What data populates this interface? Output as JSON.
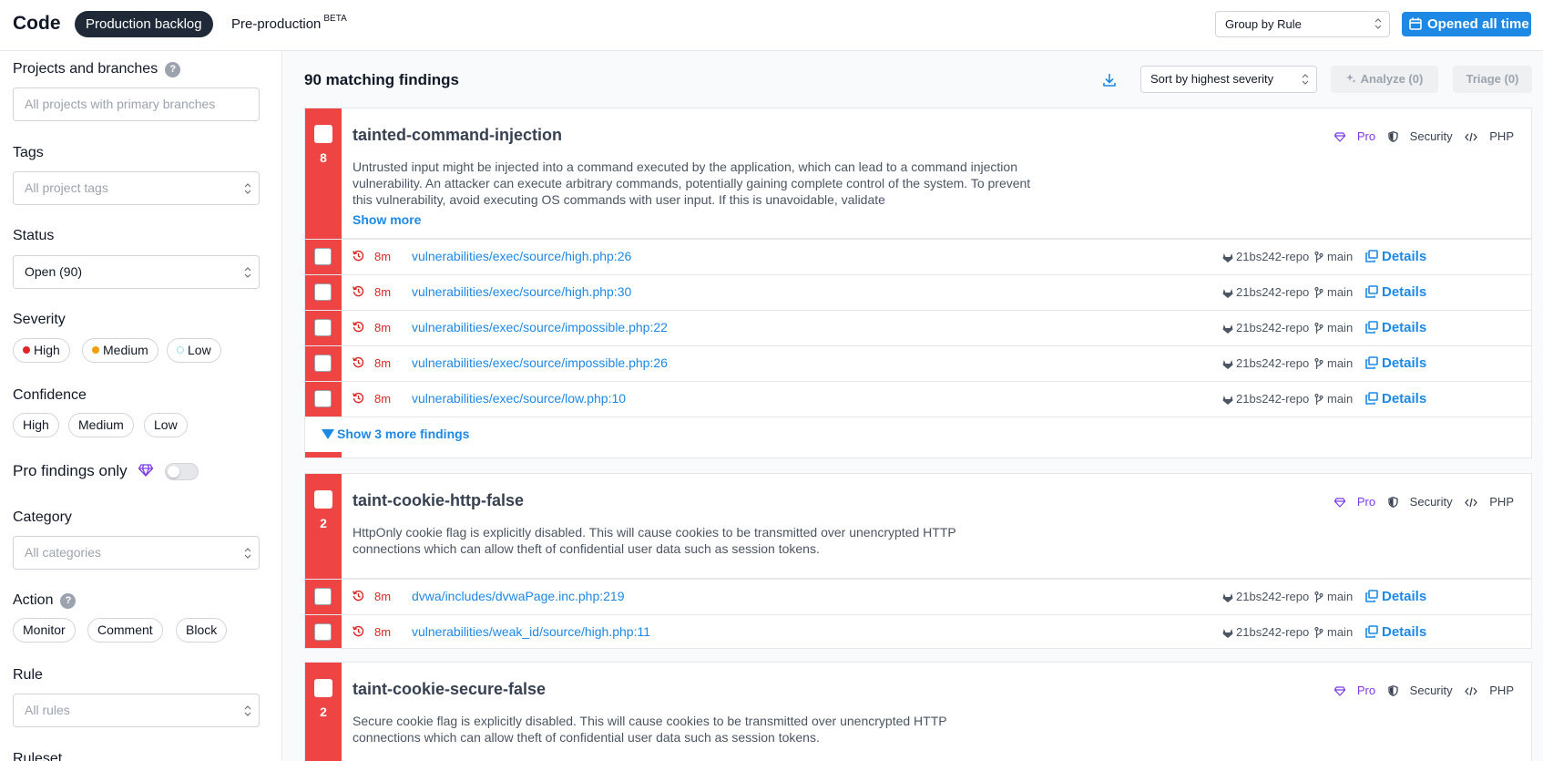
{
  "header": {
    "brand": "Code",
    "tab_production": "Production backlog",
    "tab_preproduction": "Pre-production",
    "tab_preproduction_badge": "BETA",
    "group_by": "Group by Rule",
    "opened_btn": "Opened all time"
  },
  "sidebar": {
    "projects_label": "Projects and branches",
    "projects_placeholder": "All projects with primary branches",
    "tags_label": "Tags",
    "tags_placeholder": "All project tags",
    "status_label": "Status",
    "status_value": "Open (90)",
    "severity_label": "Severity",
    "severity_options": [
      {
        "label": "High",
        "color": "#dc2626"
      },
      {
        "label": "Medium",
        "color": "#f59e0b"
      },
      {
        "label": "Low",
        "color": "#a5e4ef"
      }
    ],
    "confidence_label": "Confidence",
    "confidence_options": [
      "High",
      "Medium",
      "Low"
    ],
    "pro_label": "Pro findings only",
    "category_label": "Category",
    "category_placeholder": "All categories",
    "action_label": "Action",
    "action_options": [
      "Monitor",
      "Comment",
      "Block"
    ],
    "rule_label": "Rule",
    "rule_placeholder": "All rules",
    "ruleset_label": "Ruleset"
  },
  "main": {
    "count_title": "90 matching findings",
    "sort_by": "Sort by highest severity",
    "analyze": "Analyze (0)",
    "triage": "Triage (0)",
    "groups": [
      {
        "rule": "tainted-command-injection",
        "count": "8",
        "tags": [
          "Pro",
          "Security",
          "PHP"
        ],
        "description": "Untrusted input might be injected into a command executed by the application, which can lead to a command injection vulnerability. An attacker can execute arbitrary commands, potentially gaining complete control of the system. To prevent this vulnerability, avoid executing OS commands with user input. If this is unavoidable, validate",
        "show_more": "Show more",
        "show_findings": "Show 3 more findings",
        "findings": [
          {
            "age": "8m",
            "path": "vulnerabilities/exec/source/high.php:26",
            "repo": "21bs242-repo",
            "branch": "main",
            "details": "Details"
          },
          {
            "age": "8m",
            "path": "vulnerabilities/exec/source/high.php:30",
            "repo": "21bs242-repo",
            "branch": "main",
            "details": "Details"
          },
          {
            "age": "8m",
            "path": "vulnerabilities/exec/source/impossible.php:22",
            "repo": "21bs242-repo",
            "branch": "main",
            "details": "Details"
          },
          {
            "age": "8m",
            "path": "vulnerabilities/exec/source/impossible.php:26",
            "repo": "21bs242-repo",
            "branch": "main",
            "details": "Details"
          },
          {
            "age": "8m",
            "path": "vulnerabilities/exec/source/low.php:10",
            "repo": "21bs242-repo",
            "branch": "main",
            "details": "Details"
          }
        ]
      },
      {
        "rule": "taint-cookie-http-false",
        "count": "2",
        "tags": [
          "Pro",
          "Security",
          "PHP"
        ],
        "description": "HttpOnly cookie flag is explicitly disabled. This will cause cookies to be transmitted over unencrypted HTTP connections which can allow theft of confidential user data such as session tokens.",
        "findings": [
          {
            "age": "8m",
            "path": "dvwa/includes/dvwaPage.inc.php:219",
            "repo": "21bs242-repo",
            "branch": "main",
            "details": "Details"
          },
          {
            "age": "8m",
            "path": "vulnerabilities/weak_id/source/high.php:11",
            "repo": "21bs242-repo",
            "branch": "main",
            "details": "Details"
          }
        ]
      },
      {
        "rule": "taint-cookie-secure-false",
        "count": "2",
        "tags": [
          "Pro",
          "Security",
          "PHP"
        ],
        "description": "Secure cookie flag is explicitly disabled. This will cause cookies to be transmitted over unencrypted HTTP connections which can allow theft of confidential user data such as session tokens."
      }
    ]
  },
  "colors": {
    "accent": "#1e88e5",
    "severity_high": "#ef4444",
    "pro": "#7c3aed"
  }
}
